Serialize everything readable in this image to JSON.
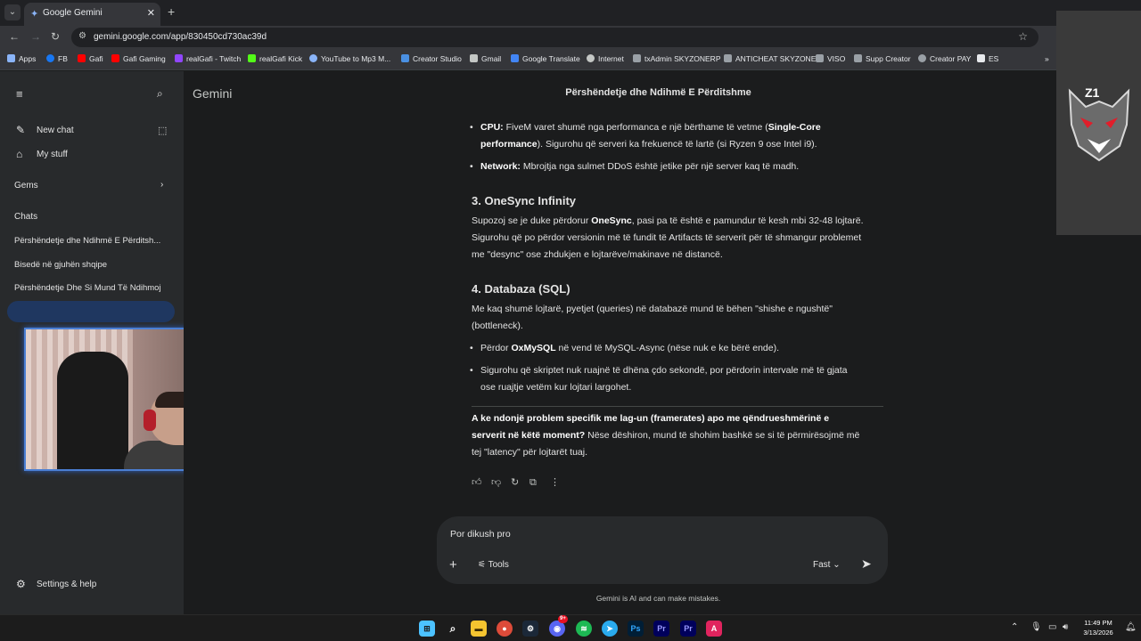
{
  "browser": {
    "tab_title": "Google Gemini",
    "url": "gemini.google.com/app/830450cd730ac39d",
    "bookmarks": [
      "Apps",
      "FB",
      "Gafi",
      "Gafi Gaming",
      "realGafi - Twitch",
      "realGafi Kick",
      "YouTube to Mp3 M...",
      "Creator Studio",
      "Gmail",
      "Google Translate",
      "Internet",
      "txAdmin SKYZONERP",
      "ANTICHEAT SKYZONE",
      "VISO",
      "Supp Creator",
      "Creator PAY",
      "ES"
    ]
  },
  "sidebar": {
    "new_chat": "New chat",
    "my_stuff": "My stuff",
    "gems": "Gems",
    "chats_heading": "Chats",
    "chats": [
      "Përshëndetje dhe Ndihmë E Përditsh...",
      "Bisedë në gjuhën shqipe",
      "Përshëndetje Dhe Si Mund Të Ndihmoj"
    ],
    "settings": "Settings & help"
  },
  "main": {
    "brand": "Gemini",
    "conversation_title": "Përshëndetje dhe Ndihmë E Përditshme",
    "cpu_label": "CPU:",
    "cpu_text_1": " FiveM varet shumë nga performanca e një bërthame të vetme (",
    "cpu_bold": "Single-Core",
    "cpu_bold_2": "performance",
    "cpu_text_2": "). Sigurohu që serveri ka frekuencë të lartë (si Ryzen 9 ose Intel i9).",
    "network_label": "Network:",
    "network_text": " Mbrojtja nga sulmet DDoS është jetike për një server kaq të madh.",
    "h_onesync": "3. OneSync Infinity",
    "onesync_text_1": "Supozoj se je duke përdorur ",
    "onesync_bold": "OneSync",
    "onesync_text_2": ", pasi pa të është e pamundur të kesh mbi 32-48 lojtarë.",
    "onesync_line_2": "Sigurohu që po përdor versionin më të fundit të Artifacts të serverit për të shmangur problemet",
    "onesync_line_3": "me \"desync\" ose zhdukjen e lojtarëve/makinave në distancë.",
    "h_db": "4. Databaza (SQL)",
    "db_line_1": "Me kaq shumë lojtarë, pyetjet (queries) në databazë mund të bëhen \"shishe e ngushtë\"",
    "db_line_2": "(bottleneck).",
    "db_b1_text_1": "Përdor ",
    "db_b1_bold": "OxMySQL",
    "db_b1_text_2": " në vend të MySQL-Async (nëse nuk e ke bërë ende).",
    "db_b2_line_1": "Sigurohu që skriptet nuk ruajnë të dhëna çdo sekondë, por përdorin intervale më të gjata",
    "db_b2_line_2": "ose ruajtje vetëm kur lojtari largohet.",
    "q_bold_1": "A ke ndonjë problem specifik me lag-un (framerates) apo me qëndrueshmërinë e",
    "q_bold_2": "serverit në këtë moment?",
    "q_text_2": " Nëse dëshiron, mund të shohim bashkë se si të përmirësojmë më",
    "q_line_3": "tej \"latency\" për lojtarët tuaj."
  },
  "composer": {
    "input_value": "Por dikush pro",
    "tools_label": "Tools",
    "mode_label": "Fast",
    "disclaimer": "Gemini is AI and can make mistakes."
  },
  "extension": {
    "logo_text": "Z1"
  },
  "taskbar": {
    "time": "11:49 PM",
    "date": "3/13/2026",
    "discord_badge": "9+"
  }
}
